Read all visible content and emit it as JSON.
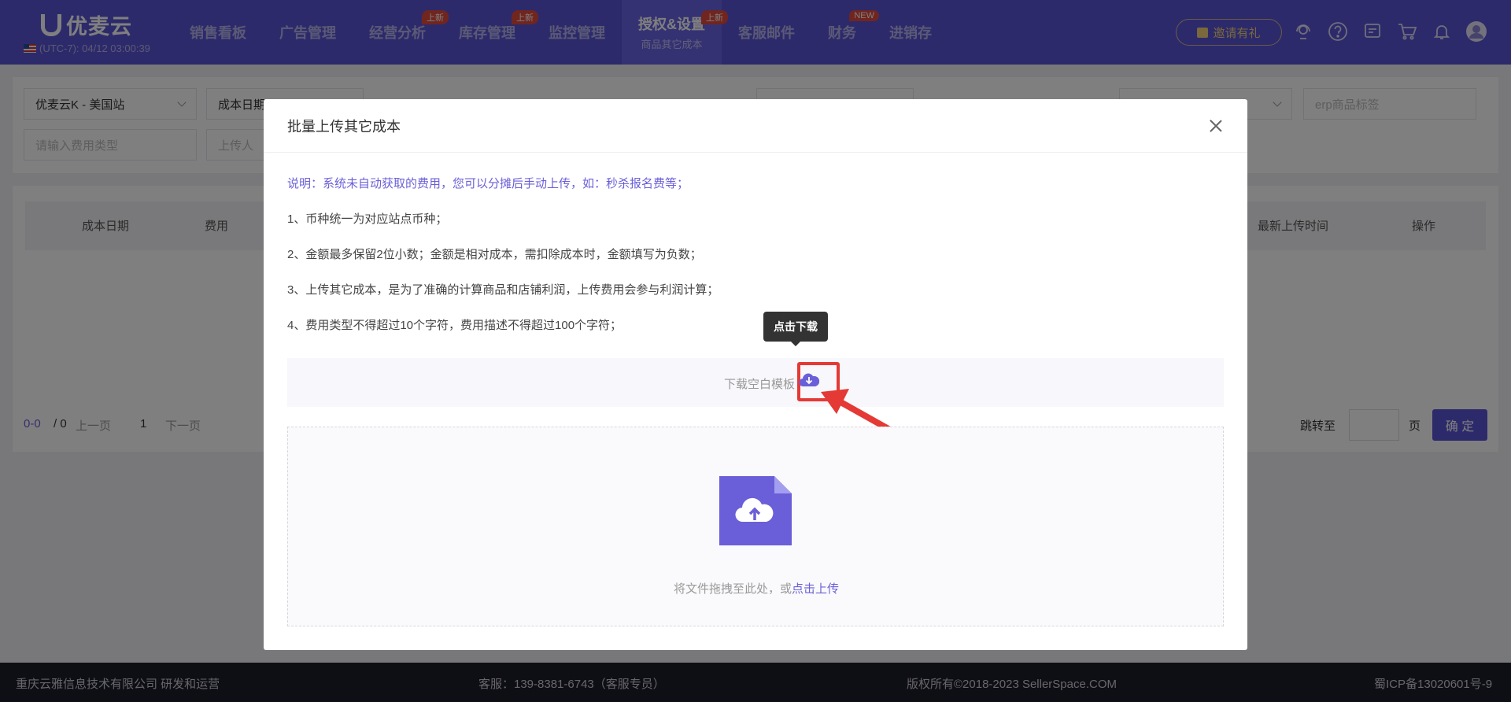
{
  "topnav": {
    "logo": "优麦云",
    "timezone": "(UTC-7): 04/12 03:00:39",
    "items": [
      {
        "label": "销售看板",
        "badge": "",
        "sub": ""
      },
      {
        "label": "广告管理",
        "badge": "",
        "sub": ""
      },
      {
        "label": "经营分析",
        "badge": "上新",
        "sub": ""
      },
      {
        "label": "库存管理",
        "badge": "上新",
        "sub": ""
      },
      {
        "label": "监控管理",
        "badge": "",
        "sub": ""
      },
      {
        "label": "授权&设置",
        "badge": "上新",
        "sub": "商品其它成本"
      },
      {
        "label": "客服邮件",
        "badge": "",
        "sub": ""
      },
      {
        "label": "财务",
        "badge": "NEW",
        "sub": ""
      },
      {
        "label": "进销存",
        "badge": "",
        "sub": ""
      }
    ],
    "invite": "邀请有礼"
  },
  "filters": {
    "store": "优麦云K - 美国站",
    "date": "成本日期",
    "fee_type_ph": "请输入费用类型",
    "uploader_ph": "上传人",
    "tag_ph": "erp商品标签"
  },
  "table": {
    "col_cost_date": "成本日期",
    "col_fee": "费用",
    "col_upload_time": "最新上传时间",
    "col_action": "操作"
  },
  "pager": {
    "count_left": "0-0",
    "count_right": "/ 0",
    "prev": "上一页",
    "page": "1",
    "next": "下一页",
    "jump": "跳转至",
    "page_unit": "页",
    "confirm": "确 定"
  },
  "modal": {
    "title": "批量上传其它成本",
    "desc": "说明：系统未自动获取的费用，您可以分摊后手动上传，如：秒杀报名费等；",
    "notes": [
      "1、币种统一为对应站点币种；",
      "2、金额最多保留2位小数；金额是相对成本，需扣除成本时，金额填写为负数；",
      "3、上传其它成本，是为了准确的计算商品和店铺利润，上传费用会参与利润计算；",
      "4、费用类型不得超过10个字符，费用描述不得超过100个字符；"
    ],
    "download_text": "下载空白模板",
    "tooltip": "点击下载",
    "drop_text": "将文件拖拽至此处，或",
    "drop_link": "点击上传"
  },
  "footer": {
    "company": "重庆云雅信息技术有限公司 研发和运营",
    "service": "客服：139-8381-6743（客服专员）",
    "copyright": "版权所有©2018-2023 SellerSpace.COM",
    "icp": "蜀ICP备13020601号-9"
  },
  "colors": {
    "primary": "#5b55d6",
    "accent": "#6a5fd8",
    "highlight": "#e53935"
  }
}
